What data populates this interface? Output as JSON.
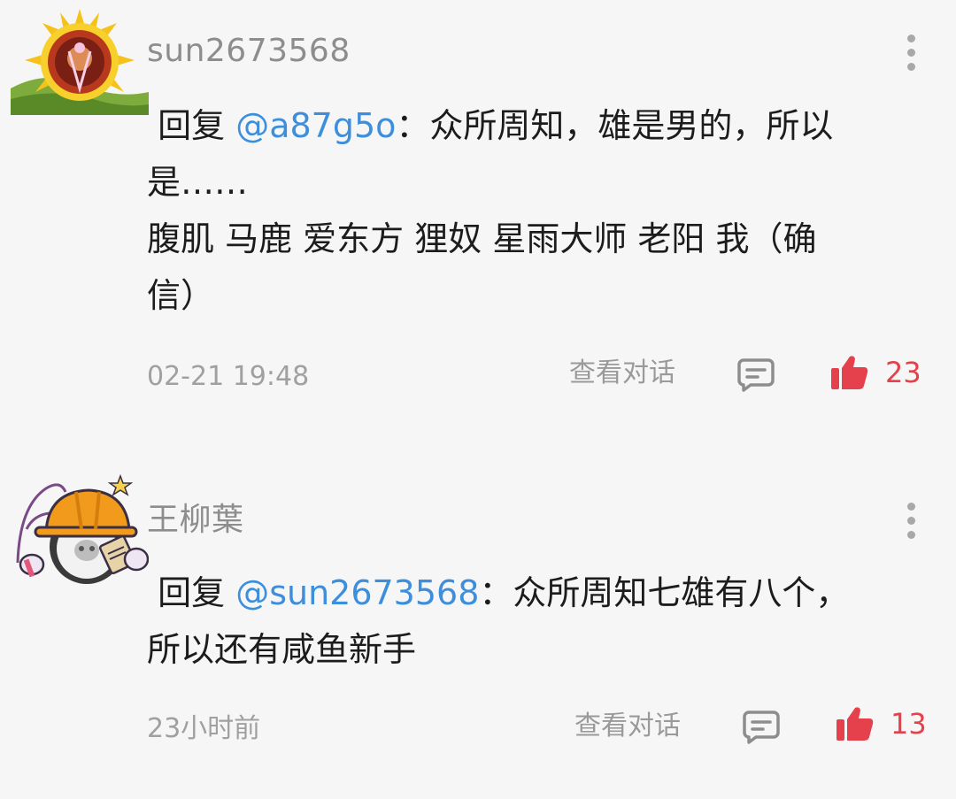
{
  "comments": [
    {
      "username": "sun2673568",
      "reply_prefix": " 回复 ",
      "mention": "@a87g5o",
      "text_line1": "：众所周知，雄是男的，所以",
      "text_rest": "是……\n腹肌 马鹿 爱东方 狸奴 星雨大师 老阳 我（确\n信）",
      "time": "02-21 19:48",
      "view_conversation": "查看对话",
      "like_count": "23"
    },
    {
      "username": "王柳葉",
      "reply_prefix": " 回复 ",
      "mention": "@sun2673568",
      "text_line1": "：众所周知七雄有八个，",
      "text_rest": "所以还有咸鱼新手",
      "time": "23小时前",
      "view_conversation": "查看对话",
      "like_count": "13"
    }
  ],
  "colors": {
    "background": "#f6f6f6",
    "mention": "#3d8fdc",
    "like": "#e5414d",
    "meta": "#a0a0a0"
  },
  "icons": {
    "more": "more-vertical-icon",
    "reply": "comment-bubble-icon",
    "like": "thumbs-up-icon"
  }
}
